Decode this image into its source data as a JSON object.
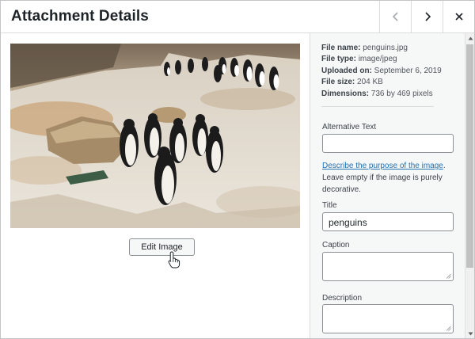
{
  "header": {
    "title": "Attachment Details"
  },
  "icons": {
    "prev": "chevron-left-icon",
    "next": "chevron-right-icon",
    "close": "close-icon"
  },
  "preview": {
    "edit_label": "Edit Image"
  },
  "meta": {
    "file_name_label": "File name:",
    "file_name": "penguins.jpg",
    "file_type_label": "File type:",
    "file_type": "image/jpeg",
    "uploaded_label": "Uploaded on:",
    "uploaded": "September 6, 2019",
    "size_label": "File size:",
    "size": "204 KB",
    "dimensions_label": "Dimensions:",
    "dimensions": "736 by 469 pixels"
  },
  "fields": {
    "alt_label": "Alternative Text",
    "alt_value": "",
    "alt_help_link": "Describe the purpose of the image",
    "alt_help_rest": "Leave empty if the image is purely decorative.",
    "title_label": "Title",
    "title_value": "penguins",
    "caption_label": "Caption",
    "caption_value": "",
    "description_label": "Description",
    "description_value": ""
  },
  "colors": {
    "link": "#2271b1",
    "border": "#8c8f94",
    "sidebar_bg": "#f6f7f7"
  }
}
